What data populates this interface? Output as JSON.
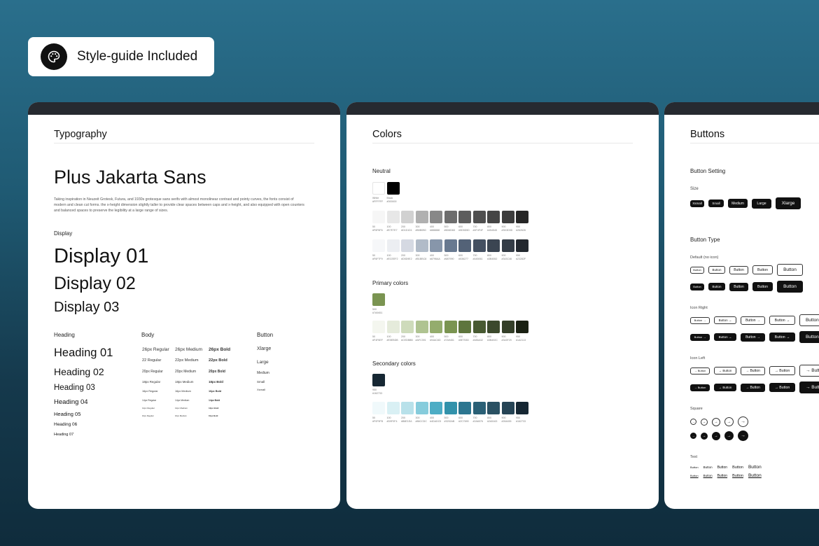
{
  "badge": {
    "label": "Style-guide Included",
    "icon": "palette-icon"
  },
  "typography": {
    "title": "Typography",
    "font_name": "Plus Jakarta Sans",
    "description": "Taking inspiration in Neuzeit Grotesk, Futura, and 1930s grotesque sans serifs with almost monolinear contrast and pointy curves, the fonts consist of modern and clean cut forms. the x-height dimension slightly taller to provide clear spaces between caps and x-height, and also equipped with open counters and balanced spaces to preserve the legibility at a large range of sizes.",
    "display_label": "Display",
    "display": [
      "Display 01",
      "Display 02",
      "Display 03"
    ],
    "heading_label": "Heading",
    "headings": [
      "Heading 01",
      "Heading 02",
      "Heading 03",
      "Heading 04",
      "Heading 05",
      "Heading 06",
      "Heading 07"
    ],
    "body_label": "Body",
    "body_rows": [
      [
        "26px Regular",
        "26px Medium",
        "26px Bold"
      ],
      [
        "22 Regular",
        "22px Medium",
        "22px Bold"
      ],
      [
        "20px Regular",
        "20px Medium",
        "20px Bold"
      ],
      [
        "18px Regular",
        "18px Medium",
        "18px Bold"
      ],
      [
        "16px Regular",
        "16px Medium",
        "16px Bold"
      ],
      [
        "14px Regular",
        "14px Medium",
        "14px Bold"
      ],
      [
        "12px Regular",
        "12px Medium",
        "12px Bold"
      ],
      [
        "10px Regular",
        "10px Medium",
        "10px Bold"
      ]
    ],
    "button_label": "Button",
    "button_sizes": [
      "Xlarge",
      "Large",
      "Medium",
      "Small",
      "Xsmall"
    ]
  },
  "colors": {
    "title": "Colors",
    "neutral_label": "Neutral",
    "neutral_base": [
      {
        "name": "White",
        "hex": "#FFFFFF"
      },
      {
        "name": "Black",
        "hex": "#000000"
      }
    ],
    "neutral_row1": [
      {
        "step": "50",
        "hex": "#F6F6F6"
      },
      {
        "step": "100",
        "hex": "#E7E7E7"
      },
      {
        "step": "200",
        "hex": "#D1D1D1"
      },
      {
        "step": "300",
        "hex": "#B0B0B0"
      },
      {
        "step": "400",
        "hex": "#888888"
      },
      {
        "step": "500",
        "hex": "#6D6D6D"
      },
      {
        "step": "600",
        "hex": "#5D5D5D"
      },
      {
        "step": "700",
        "hex": "#4F4F4F"
      },
      {
        "step": "800",
        "hex": "#454545"
      },
      {
        "step": "900",
        "hex": "#3D3D3D"
      },
      {
        "step": "950",
        "hex": "#262626"
      }
    ],
    "neutral_row2": [
      {
        "step": "50",
        "hex": "#F6F7F9"
      },
      {
        "step": "100",
        "hex": "#ECEEF2"
      },
      {
        "step": "200",
        "hex": "#D5D9E2"
      },
      {
        "step": "300",
        "hex": "#B1BBC8"
      },
      {
        "step": "400",
        "hex": "#8796AA"
      },
      {
        "step": "500",
        "hex": "#687990"
      },
      {
        "step": "600",
        "hex": "#536277"
      },
      {
        "step": "700",
        "hex": "#445061"
      },
      {
        "step": "800",
        "hex": "#3B4552"
      },
      {
        "step": "900",
        "hex": "#343C46"
      },
      {
        "step": "950",
        "hex": "#23282F"
      }
    ],
    "primary_label": "Primary colors",
    "primary_base": {
      "step": "500",
      "hex": "#7A9451"
    },
    "primary_row": [
      {
        "step": "50",
        "hex": "#F4F6EF"
      },
      {
        "step": "100",
        "hex": "#E5EBDB"
      },
      {
        "step": "200",
        "hex": "#CEDBBB"
      },
      {
        "step": "300",
        "hex": "#AFC391"
      },
      {
        "step": "400",
        "hex": "#94AC6D"
      },
      {
        "step": "500",
        "hex": "#7A9451"
      },
      {
        "step": "600",
        "hex": "#5E753D"
      },
      {
        "step": "700",
        "hex": "#485A32"
      },
      {
        "step": "800",
        "hex": "#3B492C"
      },
      {
        "step": "900",
        "hex": "#343F29"
      },
      {
        "step": "950",
        "hex": "#1A2113"
      }
    ],
    "secondary_label": "Secondary colors",
    "secondary_base": {
      "step": "950",
      "hex": "#162733"
    },
    "secondary_row": [
      {
        "step": "50",
        "hex": "#F0F9FB"
      },
      {
        "step": "100",
        "hex": "#D9F0F4"
      },
      {
        "step": "200",
        "hex": "#B8E1EA"
      },
      {
        "step": "300",
        "hex": "#86CCDC"
      },
      {
        "step": "400",
        "hex": "#4DADC5"
      },
      {
        "step": "500",
        "hex": "#3292AB"
      },
      {
        "step": "600",
        "hex": "#2C7690"
      },
      {
        "step": "700",
        "hex": "#2A6076"
      },
      {
        "step": "800",
        "hex": "#2A5163"
      },
      {
        "step": "900",
        "hex": "#264455"
      },
      {
        "step": "950",
        "hex": "#162733"
      }
    ]
  },
  "buttons": {
    "title": "Buttons",
    "setting_label": "Button Setting",
    "size_label": "Size",
    "sizes": [
      "Xsmall",
      "Small",
      "Medium",
      "Large",
      "Xlarge"
    ],
    "type_label": "Button Type",
    "default_label": "Default (no icon)",
    "icon_right_label": "Icon Right",
    "icon_left_label": "Icon Left",
    "square_label": "Square",
    "text_label": "Text",
    "button_text": "Button",
    "arrow": "→"
  }
}
